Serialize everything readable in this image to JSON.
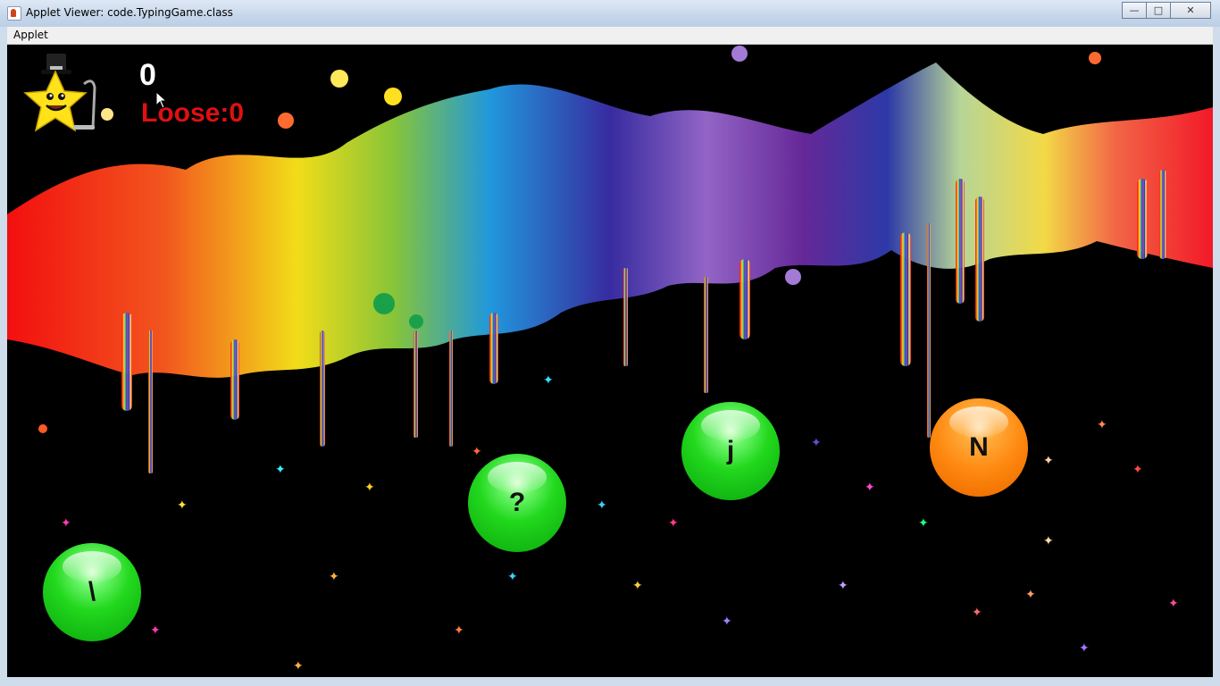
{
  "window": {
    "title": "Applet Viewer: code.TypingGame.class"
  },
  "menu": {
    "items": [
      "Applet"
    ]
  },
  "game": {
    "score": "0",
    "loose_label": "Loose:0",
    "bubbles": [
      {
        "char": "\\",
        "color": "green"
      },
      {
        "char": "?",
        "color": "green"
      },
      {
        "char": "j",
        "color": "green"
      },
      {
        "char": "N",
        "color": "orange"
      }
    ]
  },
  "colors": {
    "loose_text": "#e01010",
    "score_text": "#ffffff",
    "bubble_green": "#22d81d",
    "bubble_orange": "#ff8a12"
  },
  "icons": [
    "java-app-icon",
    "minimize-icon",
    "maximize-icon",
    "close-icon",
    "star-mascot-icon",
    "mouse-cursor-icon"
  ]
}
